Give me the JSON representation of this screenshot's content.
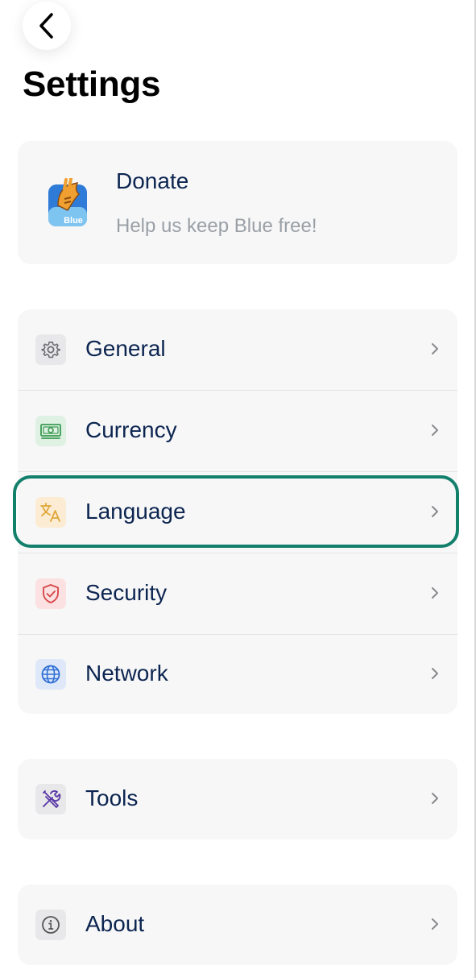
{
  "header": {
    "back_icon": "chevron-left-icon",
    "title": "Settings"
  },
  "donate": {
    "title": "Donate",
    "subtitle": "Help us keep Blue free!",
    "logo_text": "Blue",
    "logo_icon": "bluewallet-logo"
  },
  "main_menu": [
    {
      "label": "General",
      "icon": "gear-icon",
      "icon_bg": "#e8e8ea",
      "icon_color": "#6b6b70"
    },
    {
      "label": "Currency",
      "icon": "banknote-icon",
      "icon_bg": "#dff1e3",
      "icon_color": "#3a9a52"
    },
    {
      "label": "Language",
      "icon": "translate-icon",
      "icon_bg": "#fbecd3",
      "icon_color": "#e0a63a"
    },
    {
      "label": "Security",
      "icon": "shield-check-icon",
      "icon_bg": "#fbe1e1",
      "icon_color": "#d8484a"
    },
    {
      "label": "Network",
      "icon": "globe-icon",
      "icon_bg": "#dfe8f8",
      "icon_color": "#2f6fd6"
    }
  ],
  "tools": {
    "label": "Tools",
    "icon": "tools-icon",
    "icon_bg": "#e8e8ea",
    "icon_color": "#5a3aa8"
  },
  "about": {
    "label": "About",
    "icon": "info-icon",
    "icon_bg": "#e8e8ea",
    "icon_color": "#555555"
  },
  "highlighted_item": "Language",
  "colors": {
    "highlight": "#13806c",
    "card_bg": "#f7f7f8",
    "text_primary": "#0c2550",
    "text_secondary": "#9aa0a6"
  }
}
